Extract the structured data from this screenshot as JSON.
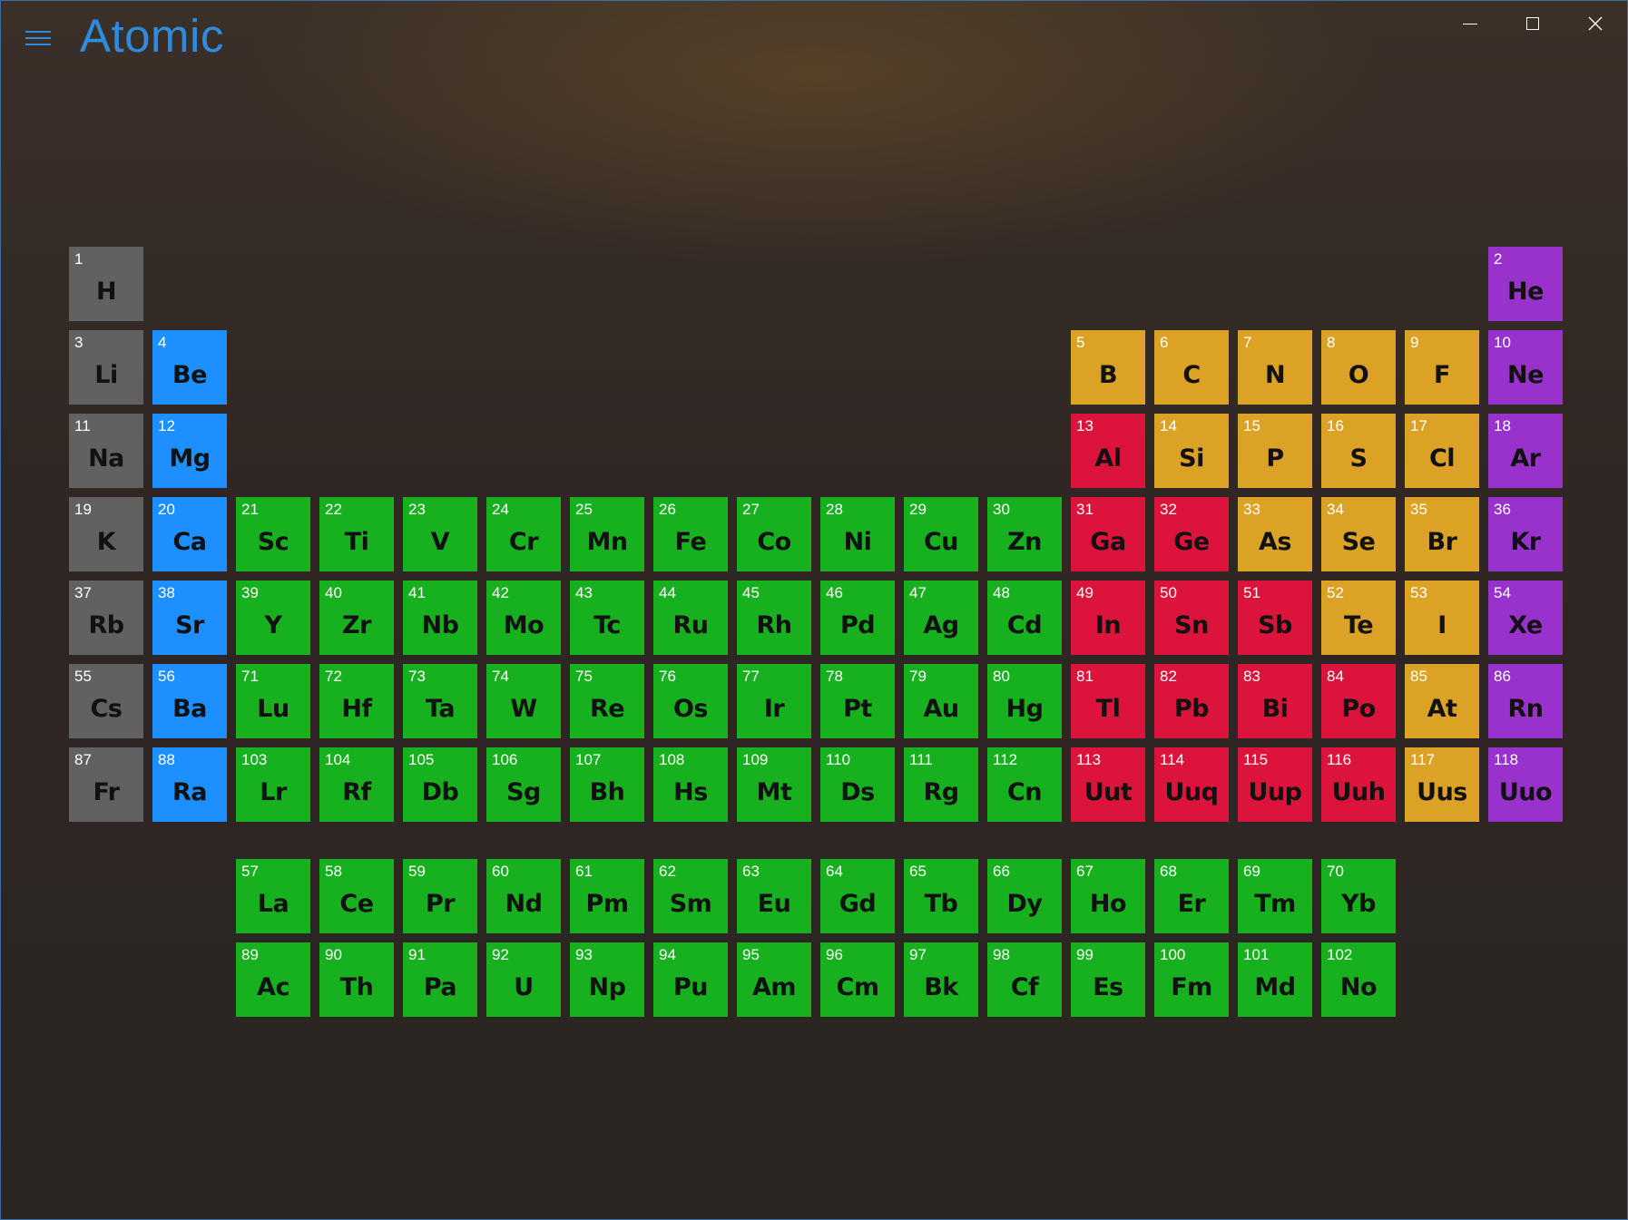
{
  "app": {
    "title": "Atomic"
  },
  "colors": {
    "gray": "#616161",
    "blue": "#1e8fff",
    "green": "#17b01e",
    "orange": "#dca225",
    "red": "#dc143c",
    "purple": "#9932cc",
    "accent": "#2e8ce0"
  },
  "window_controls": {
    "minimize": "minimize-icon",
    "maximize": "maximize-icon",
    "close": "close-icon"
  },
  "elements": [
    {
      "n": "1",
      "s": "H",
      "r": 1,
      "c": 1,
      "cat": "gray"
    },
    {
      "n": "2",
      "s": "He",
      "r": 1,
      "c": 18,
      "cat": "purple"
    },
    {
      "n": "3",
      "s": "Li",
      "r": 2,
      "c": 1,
      "cat": "gray"
    },
    {
      "n": "4",
      "s": "Be",
      "r": 2,
      "c": 2,
      "cat": "blue"
    },
    {
      "n": "5",
      "s": "B",
      "r": 2,
      "c": 13,
      "cat": "orange"
    },
    {
      "n": "6",
      "s": "C",
      "r": 2,
      "c": 14,
      "cat": "orange"
    },
    {
      "n": "7",
      "s": "N",
      "r": 2,
      "c": 15,
      "cat": "orange"
    },
    {
      "n": "8",
      "s": "O",
      "r": 2,
      "c": 16,
      "cat": "orange"
    },
    {
      "n": "9",
      "s": "F",
      "r": 2,
      "c": 17,
      "cat": "orange"
    },
    {
      "n": "10",
      "s": "Ne",
      "r": 2,
      "c": 18,
      "cat": "purple"
    },
    {
      "n": "11",
      "s": "Na",
      "r": 3,
      "c": 1,
      "cat": "gray"
    },
    {
      "n": "12",
      "s": "Mg",
      "r": 3,
      "c": 2,
      "cat": "blue"
    },
    {
      "n": "13",
      "s": "Al",
      "r": 3,
      "c": 13,
      "cat": "red"
    },
    {
      "n": "14",
      "s": "Si",
      "r": 3,
      "c": 14,
      "cat": "orange"
    },
    {
      "n": "15",
      "s": "P",
      "r": 3,
      "c": 15,
      "cat": "orange"
    },
    {
      "n": "16",
      "s": "S",
      "r": 3,
      "c": 16,
      "cat": "orange"
    },
    {
      "n": "17",
      "s": "Cl",
      "r": 3,
      "c": 17,
      "cat": "orange"
    },
    {
      "n": "18",
      "s": "Ar",
      "r": 3,
      "c": 18,
      "cat": "purple"
    },
    {
      "n": "19",
      "s": "K",
      "r": 4,
      "c": 1,
      "cat": "gray"
    },
    {
      "n": "20",
      "s": "Ca",
      "r": 4,
      "c": 2,
      "cat": "blue"
    },
    {
      "n": "21",
      "s": "Sc",
      "r": 4,
      "c": 3,
      "cat": "green"
    },
    {
      "n": "22",
      "s": "Ti",
      "r": 4,
      "c": 4,
      "cat": "green"
    },
    {
      "n": "23",
      "s": "V",
      "r": 4,
      "c": 5,
      "cat": "green"
    },
    {
      "n": "24",
      "s": "Cr",
      "r": 4,
      "c": 6,
      "cat": "green"
    },
    {
      "n": "25",
      "s": "Mn",
      "r": 4,
      "c": 7,
      "cat": "green"
    },
    {
      "n": "26",
      "s": "Fe",
      "r": 4,
      "c": 8,
      "cat": "green"
    },
    {
      "n": "27",
      "s": "Co",
      "r": 4,
      "c": 9,
      "cat": "green"
    },
    {
      "n": "28",
      "s": "Ni",
      "r": 4,
      "c": 10,
      "cat": "green"
    },
    {
      "n": "29",
      "s": "Cu",
      "r": 4,
      "c": 11,
      "cat": "green"
    },
    {
      "n": "30",
      "s": "Zn",
      "r": 4,
      "c": 12,
      "cat": "green"
    },
    {
      "n": "31",
      "s": "Ga",
      "r": 4,
      "c": 13,
      "cat": "red"
    },
    {
      "n": "32",
      "s": "Ge",
      "r": 4,
      "c": 14,
      "cat": "red"
    },
    {
      "n": "33",
      "s": "As",
      "r": 4,
      "c": 15,
      "cat": "orange"
    },
    {
      "n": "34",
      "s": "Se",
      "r": 4,
      "c": 16,
      "cat": "orange"
    },
    {
      "n": "35",
      "s": "Br",
      "r": 4,
      "c": 17,
      "cat": "orange"
    },
    {
      "n": "36",
      "s": "Kr",
      "r": 4,
      "c": 18,
      "cat": "purple"
    },
    {
      "n": "37",
      "s": "Rb",
      "r": 5,
      "c": 1,
      "cat": "gray"
    },
    {
      "n": "38",
      "s": "Sr",
      "r": 5,
      "c": 2,
      "cat": "blue"
    },
    {
      "n": "39",
      "s": "Y",
      "r": 5,
      "c": 3,
      "cat": "green"
    },
    {
      "n": "40",
      "s": "Zr",
      "r": 5,
      "c": 4,
      "cat": "green"
    },
    {
      "n": "41",
      "s": "Nb",
      "r": 5,
      "c": 5,
      "cat": "green"
    },
    {
      "n": "42",
      "s": "Mo",
      "r": 5,
      "c": 6,
      "cat": "green"
    },
    {
      "n": "43",
      "s": "Tc",
      "r": 5,
      "c": 7,
      "cat": "green"
    },
    {
      "n": "44",
      "s": "Ru",
      "r": 5,
      "c": 8,
      "cat": "green"
    },
    {
      "n": "45",
      "s": "Rh",
      "r": 5,
      "c": 9,
      "cat": "green"
    },
    {
      "n": "46",
      "s": "Pd",
      "r": 5,
      "c": 10,
      "cat": "green"
    },
    {
      "n": "47",
      "s": "Ag",
      "r": 5,
      "c": 11,
      "cat": "green"
    },
    {
      "n": "48",
      "s": "Cd",
      "r": 5,
      "c": 12,
      "cat": "green"
    },
    {
      "n": "49",
      "s": "In",
      "r": 5,
      "c": 13,
      "cat": "red"
    },
    {
      "n": "50",
      "s": "Sn",
      "r": 5,
      "c": 14,
      "cat": "red"
    },
    {
      "n": "51",
      "s": "Sb",
      "r": 5,
      "c": 15,
      "cat": "red"
    },
    {
      "n": "52",
      "s": "Te",
      "r": 5,
      "c": 16,
      "cat": "orange"
    },
    {
      "n": "53",
      "s": "I",
      "r": 5,
      "c": 17,
      "cat": "orange"
    },
    {
      "n": "54",
      "s": "Xe",
      "r": 5,
      "c": 18,
      "cat": "purple"
    },
    {
      "n": "55",
      "s": "Cs",
      "r": 6,
      "c": 1,
      "cat": "gray"
    },
    {
      "n": "56",
      "s": "Ba",
      "r": 6,
      "c": 2,
      "cat": "blue"
    },
    {
      "n": "71",
      "s": "Lu",
      "r": 6,
      "c": 3,
      "cat": "green"
    },
    {
      "n": "72",
      "s": "Hf",
      "r": 6,
      "c": 4,
      "cat": "green"
    },
    {
      "n": "73",
      "s": "Ta",
      "r": 6,
      "c": 5,
      "cat": "green"
    },
    {
      "n": "74",
      "s": "W",
      "r": 6,
      "c": 6,
      "cat": "green"
    },
    {
      "n": "75",
      "s": "Re",
      "r": 6,
      "c": 7,
      "cat": "green"
    },
    {
      "n": "76",
      "s": "Os",
      "r": 6,
      "c": 8,
      "cat": "green"
    },
    {
      "n": "77",
      "s": "Ir",
      "r": 6,
      "c": 9,
      "cat": "green"
    },
    {
      "n": "78",
      "s": "Pt",
      "r": 6,
      "c": 10,
      "cat": "green"
    },
    {
      "n": "79",
      "s": "Au",
      "r": 6,
      "c": 11,
      "cat": "green"
    },
    {
      "n": "80",
      "s": "Hg",
      "r": 6,
      "c": 12,
      "cat": "green"
    },
    {
      "n": "81",
      "s": "Tl",
      "r": 6,
      "c": 13,
      "cat": "red"
    },
    {
      "n": "82",
      "s": "Pb",
      "r": 6,
      "c": 14,
      "cat": "red"
    },
    {
      "n": "83",
      "s": "Bi",
      "r": 6,
      "c": 15,
      "cat": "red"
    },
    {
      "n": "84",
      "s": "Po",
      "r": 6,
      "c": 16,
      "cat": "red"
    },
    {
      "n": "85",
      "s": "At",
      "r": 6,
      "c": 17,
      "cat": "orange"
    },
    {
      "n": "86",
      "s": "Rn",
      "r": 6,
      "c": 18,
      "cat": "purple"
    },
    {
      "n": "87",
      "s": "Fr",
      "r": 7,
      "c": 1,
      "cat": "gray"
    },
    {
      "n": "88",
      "s": "Ra",
      "r": 7,
      "c": 2,
      "cat": "blue"
    },
    {
      "n": "103",
      "s": "Lr",
      "r": 7,
      "c": 3,
      "cat": "green"
    },
    {
      "n": "104",
      "s": "Rf",
      "r": 7,
      "c": 4,
      "cat": "green"
    },
    {
      "n": "105",
      "s": "Db",
      "r": 7,
      "c": 5,
      "cat": "green"
    },
    {
      "n": "106",
      "s": "Sg",
      "r": 7,
      "c": 6,
      "cat": "green"
    },
    {
      "n": "107",
      "s": "Bh",
      "r": 7,
      "c": 7,
      "cat": "green"
    },
    {
      "n": "108",
      "s": "Hs",
      "r": 7,
      "c": 8,
      "cat": "green"
    },
    {
      "n": "109",
      "s": "Mt",
      "r": 7,
      "c": 9,
      "cat": "green"
    },
    {
      "n": "110",
      "s": "Ds",
      "r": 7,
      "c": 10,
      "cat": "green"
    },
    {
      "n": "111",
      "s": "Rg",
      "r": 7,
      "c": 11,
      "cat": "green"
    },
    {
      "n": "112",
      "s": "Cn",
      "r": 7,
      "c": 12,
      "cat": "green"
    },
    {
      "n": "113",
      "s": "Uut",
      "r": 7,
      "c": 13,
      "cat": "red"
    },
    {
      "n": "114",
      "s": "Uuq",
      "r": 7,
      "c": 14,
      "cat": "red"
    },
    {
      "n": "115",
      "s": "Uup",
      "r": 7,
      "c": 15,
      "cat": "red"
    },
    {
      "n": "116",
      "s": "Uuh",
      "r": 7,
      "c": 16,
      "cat": "red"
    },
    {
      "n": "117",
      "s": "Uus",
      "r": 7,
      "c": 17,
      "cat": "orange"
    },
    {
      "n": "118",
      "s": "Uuo",
      "r": 7,
      "c": 18,
      "cat": "purple"
    },
    {
      "n": "57",
      "s": "La",
      "r": 8,
      "c": 3,
      "cat": "green"
    },
    {
      "n": "58",
      "s": "Ce",
      "r": 8,
      "c": 4,
      "cat": "green"
    },
    {
      "n": "59",
      "s": "Pr",
      "r": 8,
      "c": 5,
      "cat": "green"
    },
    {
      "n": "60",
      "s": "Nd",
      "r": 8,
      "c": 6,
      "cat": "green"
    },
    {
      "n": "61",
      "s": "Pm",
      "r": 8,
      "c": 7,
      "cat": "green"
    },
    {
      "n": "62",
      "s": "Sm",
      "r": 8,
      "c": 8,
      "cat": "green"
    },
    {
      "n": "63",
      "s": "Eu",
      "r": 8,
      "c": 9,
      "cat": "green"
    },
    {
      "n": "64",
      "s": "Gd",
      "r": 8,
      "c": 10,
      "cat": "green"
    },
    {
      "n": "65",
      "s": "Tb",
      "r": 8,
      "c": 11,
      "cat": "green"
    },
    {
      "n": "66",
      "s": "Dy",
      "r": 8,
      "c": 12,
      "cat": "green"
    },
    {
      "n": "67",
      "s": "Ho",
      "r": 8,
      "c": 13,
      "cat": "green"
    },
    {
      "n": "68",
      "s": "Er",
      "r": 8,
      "c": 14,
      "cat": "green"
    },
    {
      "n": "69",
      "s": "Tm",
      "r": 8,
      "c": 15,
      "cat": "green"
    },
    {
      "n": "70",
      "s": "Yb",
      "r": 8,
      "c": 16,
      "cat": "green"
    },
    {
      "n": "89",
      "s": "Ac",
      "r": 9,
      "c": 3,
      "cat": "green"
    },
    {
      "n": "90",
      "s": "Th",
      "r": 9,
      "c": 4,
      "cat": "green"
    },
    {
      "n": "91",
      "s": "Pa",
      "r": 9,
      "c": 5,
      "cat": "green"
    },
    {
      "n": "92",
      "s": "U",
      "r": 9,
      "c": 6,
      "cat": "green"
    },
    {
      "n": "93",
      "s": "Np",
      "r": 9,
      "c": 7,
      "cat": "green"
    },
    {
      "n": "94",
      "s": "Pu",
      "r": 9,
      "c": 8,
      "cat": "green"
    },
    {
      "n": "95",
      "s": "Am",
      "r": 9,
      "c": 9,
      "cat": "green"
    },
    {
      "n": "96",
      "s": "Cm",
      "r": 9,
      "c": 10,
      "cat": "green"
    },
    {
      "n": "97",
      "s": "Bk",
      "r": 9,
      "c": 11,
      "cat": "green"
    },
    {
      "n": "98",
      "s": "Cf",
      "r": 9,
      "c": 12,
      "cat": "green"
    },
    {
      "n": "99",
      "s": "Es",
      "r": 9,
      "c": 13,
      "cat": "green"
    },
    {
      "n": "100",
      "s": "Fm",
      "r": 9,
      "c": 14,
      "cat": "green"
    },
    {
      "n": "101",
      "s": "Md",
      "r": 9,
      "c": 15,
      "cat": "green"
    },
    {
      "n": "102",
      "s": "No",
      "r": 9,
      "c": 16,
      "cat": "green"
    }
  ]
}
